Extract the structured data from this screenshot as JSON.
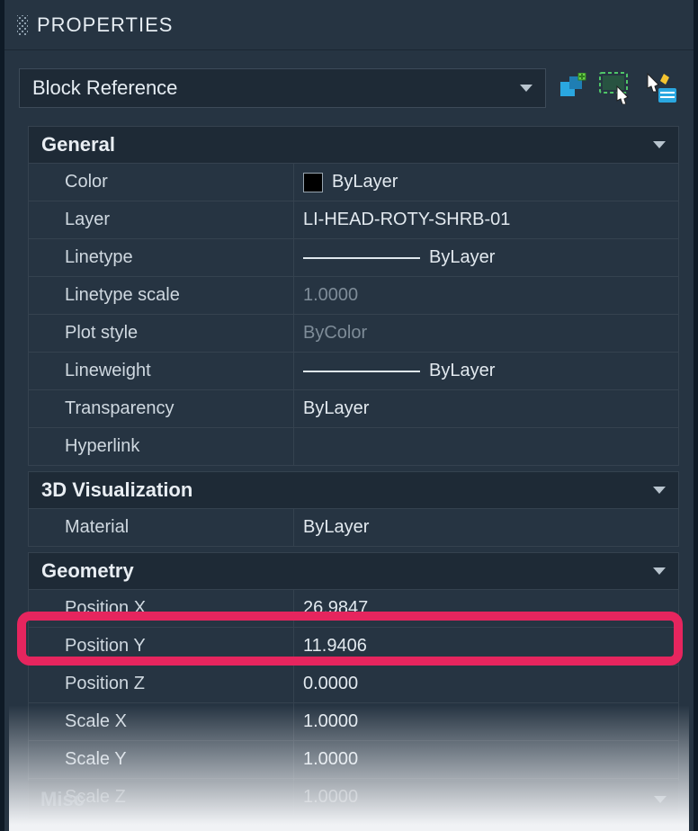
{
  "panel": {
    "title": "PROPERTIES"
  },
  "selector": {
    "type": "Block Reference"
  },
  "icons": {
    "toggle_pim": "toggle-pim-icon",
    "quick_select": "quick-select-icon",
    "quick_properties": "quick-properties-icon"
  },
  "sections": {
    "general": {
      "title": "General",
      "rows": {
        "color": {
          "label": "Color",
          "value": "ByLayer"
        },
        "layer": {
          "label": "Layer",
          "value": "LI-HEAD-ROTY-SHRB-01"
        },
        "linetype": {
          "label": "Linetype",
          "value": "ByLayer"
        },
        "linetype_scale": {
          "label": "Linetype scale",
          "value": "1.0000"
        },
        "plot_style": {
          "label": "Plot style",
          "value": "ByColor"
        },
        "lineweight": {
          "label": "Lineweight",
          "value": "ByLayer"
        },
        "transparency": {
          "label": "Transparency",
          "value": "ByLayer"
        },
        "hyperlink": {
          "label": "Hyperlink",
          "value": ""
        }
      }
    },
    "visualization": {
      "title": "3D Visualization",
      "rows": {
        "material": {
          "label": "Material",
          "value": "ByLayer"
        }
      }
    },
    "geometry": {
      "title": "Geometry",
      "rows": {
        "pos_x": {
          "label": "Position X",
          "value": "26.9847"
        },
        "pos_y": {
          "label": "Position Y",
          "value": "11.9406"
        },
        "pos_z": {
          "label": "Position Z",
          "value": "0.0000"
        },
        "scale_x": {
          "label": "Scale X",
          "value": "1.0000"
        },
        "scale_y": {
          "label": "Scale Y",
          "value": "1.0000"
        },
        "scale_z": {
          "label": "Scale Z",
          "value": "1.0000"
        }
      }
    },
    "misc": {
      "title": "Misc"
    }
  },
  "colors": {
    "highlight": "#e6255e",
    "panel_bg": "#263442",
    "section_bg": "#1e2a36"
  }
}
